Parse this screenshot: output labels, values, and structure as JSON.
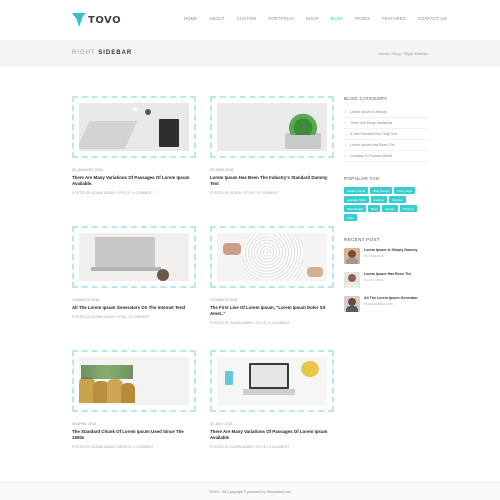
{
  "header": {
    "logo_text": "TOVO",
    "nav": [
      {
        "label": "HOME",
        "active": false
      },
      {
        "label": "ABOUT",
        "active": false
      },
      {
        "label": "CUSTOM",
        "active": false
      },
      {
        "label": "PORTFOLIO",
        "active": false
      },
      {
        "label": "SHOP",
        "active": false
      },
      {
        "label": "BLOG",
        "active": true
      },
      {
        "label": "PAGES",
        "active": false
      },
      {
        "label": "FEATURES",
        "active": false
      },
      {
        "label": "CONTACT US",
        "active": false
      }
    ]
  },
  "titlebar": {
    "title_light": "RIGHT",
    "title_bold": "SIDEBAR",
    "breadcrumb": "Home / Blog / Right Sidebar"
  },
  "posts": [
    {
      "date": "05 JANUARY 2018",
      "title": "There Are Many Variations Of Passages Of Lorem Ipsum Available.",
      "meta": "POSTED BY ADMIN ADMIN  /  OFFICE  /  4 COMMENT"
    },
    {
      "date": "25 JUNE 2018",
      "title": "Lorem Ipsum Has Been The Industry's Standard Dummy Text",
      "meta": "POSTED BY ADMIN  /  STYLE  /  5 COMMENT"
    },
    {
      "date": "15 MARCH 2018",
      "title": "All The Lorem Ipsum Generators On The Internet Tend",
      "meta": "POSTED BY ADMIN ADMIN  /  HTML  /  4 COMMENT"
    },
    {
      "date": "20 MARCH 2018",
      "title": "The First Line Of Lorem Ipsum, \"Lorem Ipsum Dolor Sit Amet..\"",
      "meta": "POSTED BY ADMIN ADMIN  /  STYLE  /  5 COMMENT"
    },
    {
      "date": "08 APRIL 2018",
      "title": "The Standard Chunk Of Lorem Ipsum Used Since The 1500s",
      "meta": "POSTED BY ADMIN ADMIN  /  DESIGN  /  4 COMMENT"
    },
    {
      "date": "20 JULY 2018",
      "title": "There Are Many Variations Of Passages Of Lorem Ipsum Available",
      "meta": "POSTED BY ADMIN ADMIN  /  STYLE  /  5 COMMENT"
    }
  ],
  "sidebar": {
    "category_title": "BLOG CATEGORY",
    "categories": [
      "Lorem Ipsum Is Simply",
      "There Are Many Variations",
      "It Has Survived Not Only Five",
      "Lorem Ipsum Has Been The",
      "Contrary To Popular Belief"
    ],
    "tags_title": "POPULAR TAG",
    "tags": [
      "Fashion Style",
      "Blog Design",
      "Party Night",
      "Animate Style",
      "Fashion",
      "Mockup",
      "Web Design",
      "Blog",
      "Design",
      "Drinking",
      "Style"
    ],
    "recent_title": "RECENT POST",
    "recent": [
      {
        "title": "Lorem Ipsum Is Simply Dummy",
        "date": "29 JUNE 2018"
      },
      {
        "title": "Lorem Ipsum Has Been The",
        "date": "20 JULY 2018"
      },
      {
        "title": "All The Lorem Ipsum Generator",
        "date": "05 DECEMBER 2018"
      }
    ]
  },
  "footer": {
    "text": "TOVO - All Copyright © powered by Templateq.com"
  },
  "colors": {
    "accent": "#2ec7c9",
    "tag_bg": "#38cdd0",
    "thumb_border": "#b8e9ea"
  }
}
